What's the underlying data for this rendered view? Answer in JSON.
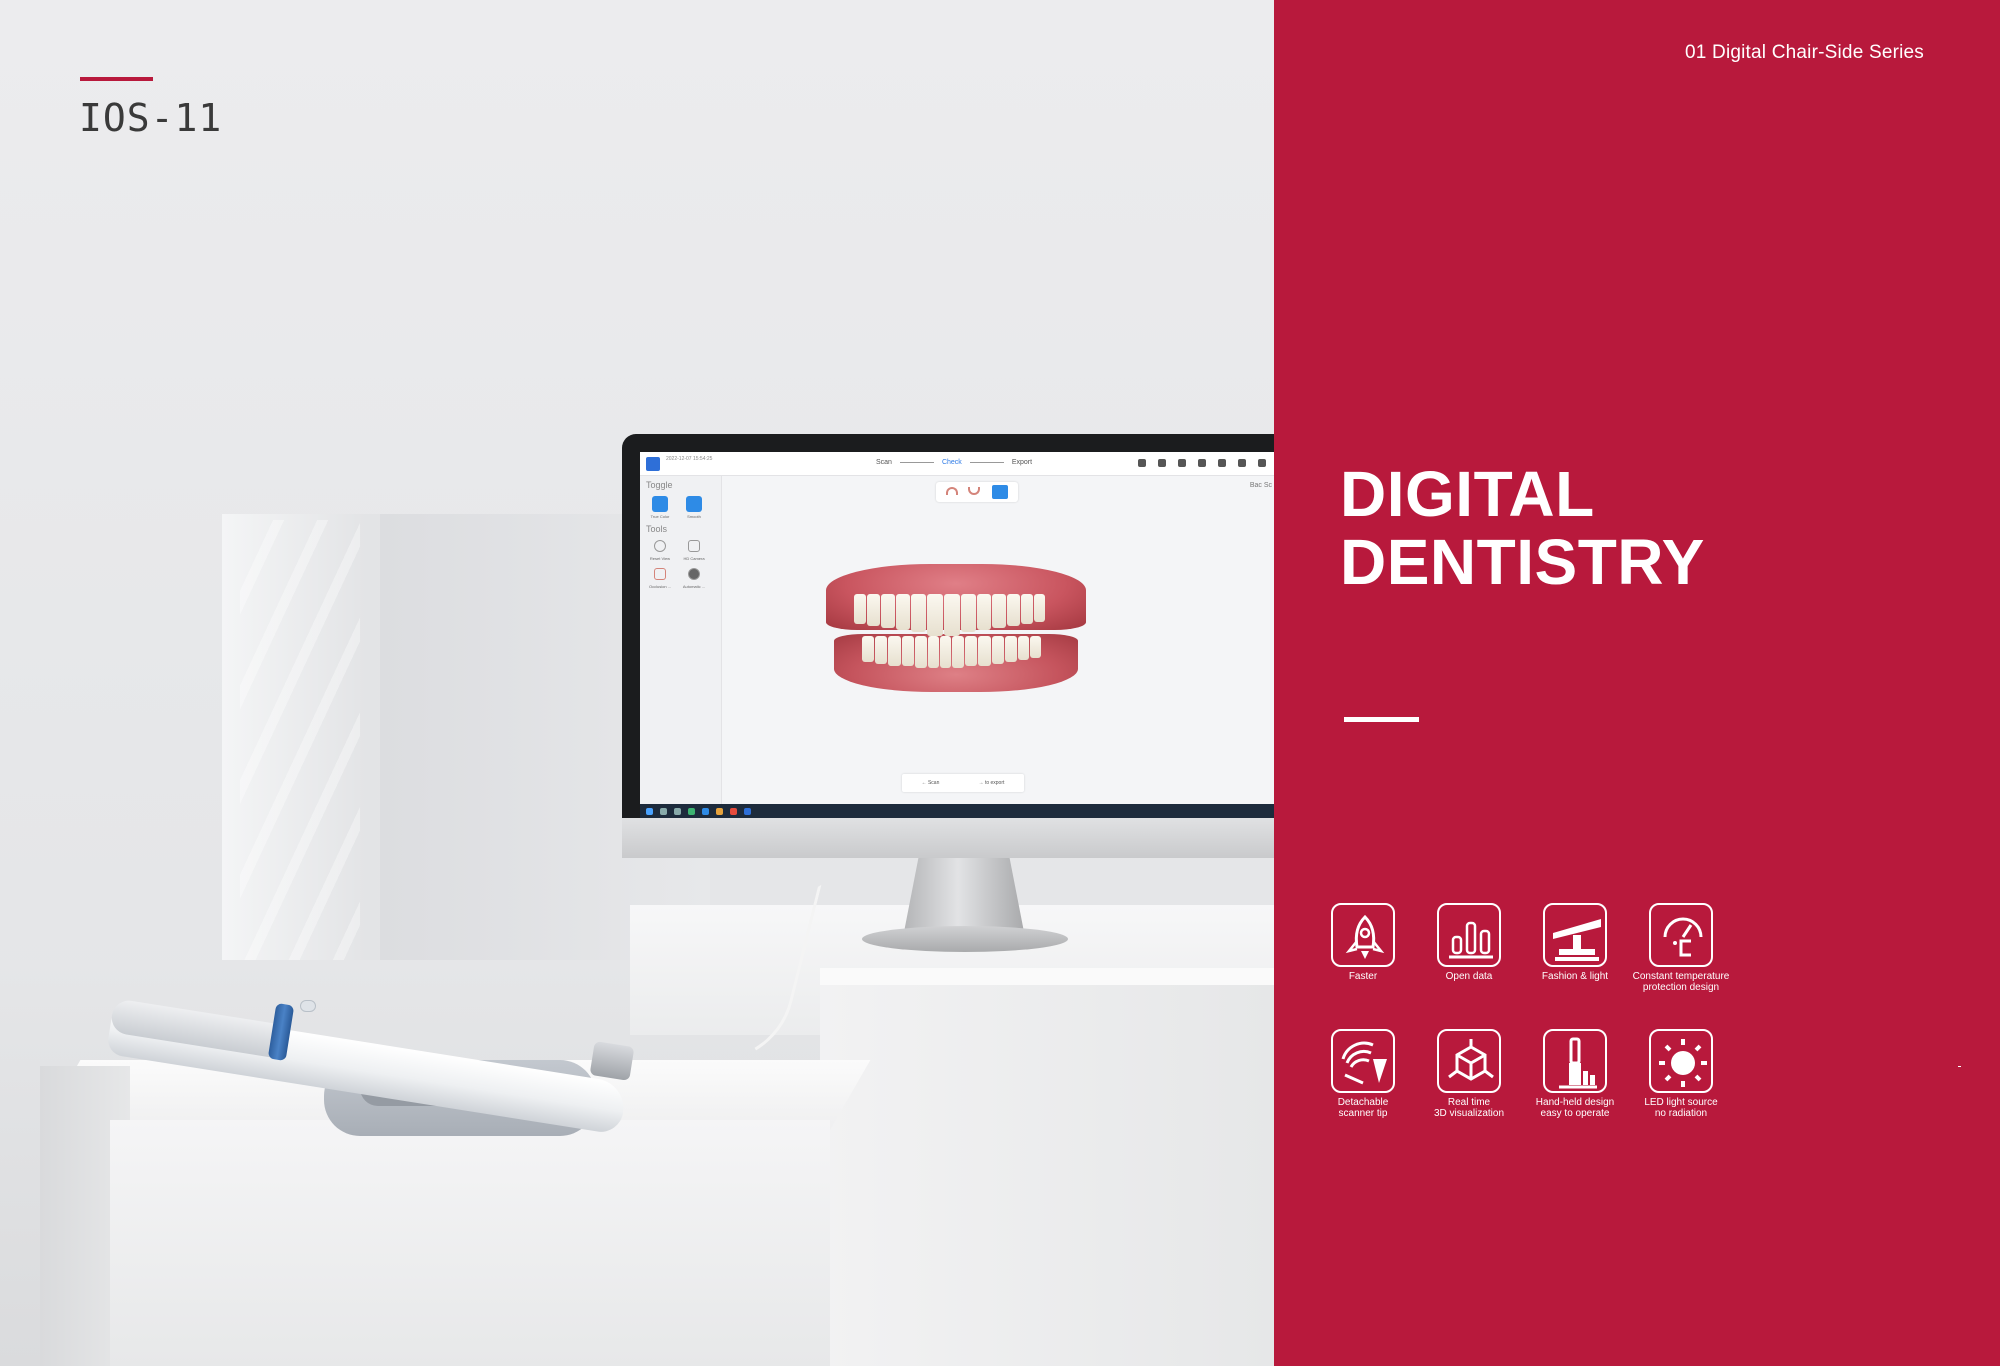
{
  "header": {
    "product_name": "IOS-11",
    "series": "01 Digital Chair-Side Series"
  },
  "headline": {
    "line1": "DIGITAL",
    "line2": "DENTISTRY"
  },
  "features": [
    {
      "label": "Faster",
      "icon": "rocket-icon"
    },
    {
      "label": "Open data",
      "icon": "bar-chart-icon"
    },
    {
      "label": "Fashion & light",
      "icon": "balance-icon"
    },
    {
      "label": "Constant temperature\nprotection design",
      "icon": "thermometer-gauge-icon"
    },
    {
      "label": "Detachable\nscanner tip",
      "icon": "scanner-tip-icon"
    },
    {
      "label": "Real time\n3D visualization",
      "icon": "3d-cube-icon"
    },
    {
      "label": "Hand-held design\neasy to operate",
      "icon": "hand-held-icon"
    },
    {
      "label": "LED light source\nno radiation",
      "icon": "sun-icon"
    }
  ],
  "screen_app": {
    "timestamp": "2022-12-07 15:54:25",
    "steps": [
      "Scan",
      "Check",
      "Export"
    ],
    "active_step": "Check",
    "sidebar": {
      "toggle_heading": "Toggle",
      "toggle_items": [
        "True Color",
        "Smooth"
      ],
      "tools_heading": "Tools",
      "tools_items": [
        "Reset View",
        "HD Camera",
        "Occlusion ...",
        "Automatic ..."
      ]
    },
    "view_label": "Bac Sc",
    "bottom_buttons": [
      "Scan",
      "to export"
    ]
  },
  "colors": {
    "accent": "#b8193c",
    "panel_text": "#ffffff",
    "product_text": "#3a3a3a"
  }
}
